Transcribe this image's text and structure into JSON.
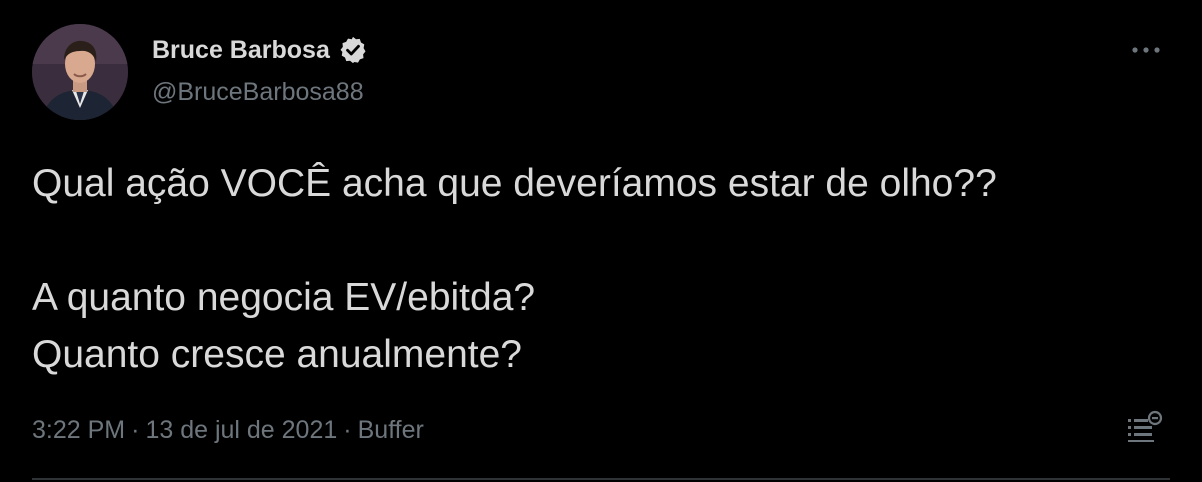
{
  "tweet": {
    "author": {
      "display_name": "Bruce Barbosa",
      "handle": "@BruceBarbosa88",
      "verified": true,
      "avatar_icon": "avatar-photo"
    },
    "lines": [
      "Qual ação VOCÊ acha que deveríamos estar de olho??",
      "",
      "A quanto negocia EV/ebitda?",
      "Quanto cresce anualmente?"
    ],
    "meta": {
      "time": "3:22 PM",
      "separator": "·",
      "date": "13 de jul de 2021",
      "source": "Buffer"
    },
    "icons": {
      "more": "more-horizontal-icon",
      "analytics": "analytics-icon",
      "verified": "verified-badge-icon"
    }
  },
  "colors": {
    "background": "#000000",
    "primary_text": "#d9d9d9",
    "secondary_text": "#6e767d",
    "divider": "#2f3336"
  }
}
